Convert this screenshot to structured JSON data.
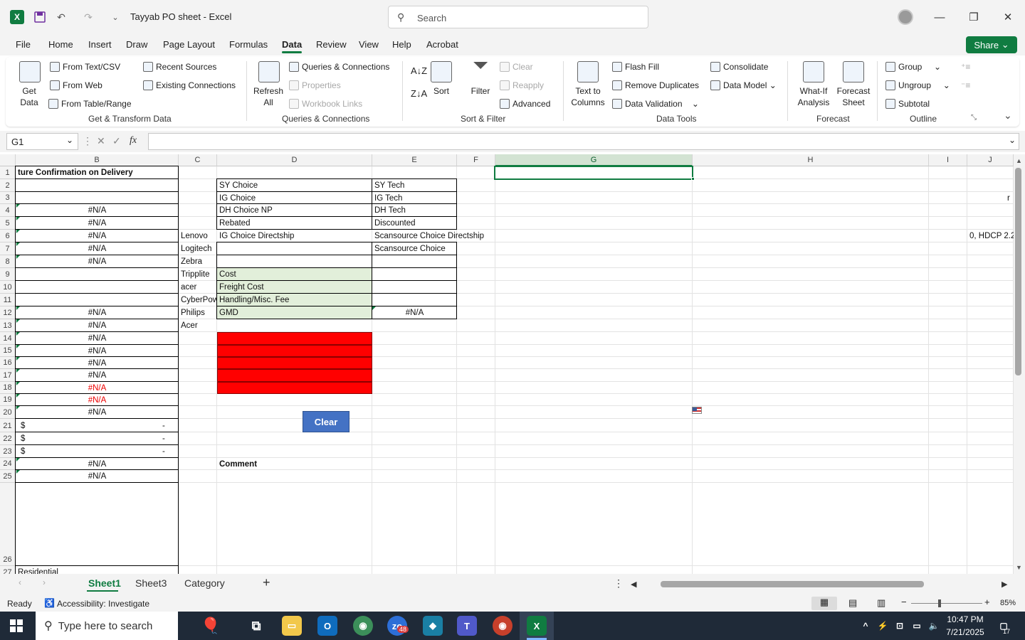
{
  "titlebar": {
    "doc_title": "Tayyab PO sheet  -  Excel",
    "search_placeholder": "Search"
  },
  "menu": {
    "items": [
      "File",
      "Home",
      "Insert",
      "Draw",
      "Page Layout",
      "Formulas",
      "Data",
      "Review",
      "View",
      "Help",
      "Acrobat"
    ],
    "active": "Data",
    "share": "Share"
  },
  "ribbon": {
    "get_data": "Get\nData",
    "from_text_csv": "From Text/CSV",
    "from_web": "From Web",
    "from_table_range": "From Table/Range",
    "recent_sources": "Recent Sources",
    "existing_connections": "Existing Connections",
    "group_get_transform": "Get & Transform Data",
    "refresh_all": "Refresh\nAll",
    "queries_connections": "Queries & Connections",
    "properties": "Properties",
    "workbook_links": "Workbook Links",
    "group_queries": "Queries & Connections",
    "sort": "Sort",
    "filter": "Filter",
    "clear": "Clear",
    "reapply": "Reapply",
    "advanced": "Advanced",
    "group_sort_filter": "Sort & Filter",
    "text_to_columns": "Text to\nColumns",
    "flash_fill": "Flash Fill",
    "remove_duplicates": "Remove Duplicates",
    "data_validation": "Data Validation",
    "consolidate": "Consolidate",
    "data_model": "Data Model",
    "group_data_tools": "Data Tools",
    "what_if": "What-If\nAnalysis",
    "forecast_sheet": "Forecast\nSheet",
    "group_forecast": "Forecast",
    "group_btn": "Group",
    "ungroup": "Ungroup",
    "subtotal": "Subtotal",
    "group_outline": "Outline"
  },
  "formula_bar": {
    "name_box": "G1",
    "formula": ""
  },
  "grid": {
    "columns": [
      "B",
      "C",
      "D",
      "E",
      "F",
      "G",
      "H",
      "I",
      "J"
    ],
    "selected_column": "G",
    "rows": [
      "1",
      "2",
      "3",
      "4",
      "5",
      "6",
      "7",
      "8",
      "9",
      "10",
      "11",
      "12",
      "13",
      "14",
      "15",
      "16",
      "17",
      "18",
      "19",
      "20",
      "21",
      "22",
      "23",
      "24",
      "25",
      "26",
      "27"
    ],
    "cells": {
      "B1": "ture Confirmation on Delivery",
      "B4": "#N/A",
      "B5": "#N/A",
      "B6": "#N/A",
      "B7": "#N/A",
      "B8": "#N/A",
      "B12": "#N/A",
      "B13": "#N/A",
      "B14": "#N/A",
      "B15": "#N/A",
      "B16": "#N/A",
      "B17": "#N/A",
      "B18": "#N/A",
      "B19": "#N/A",
      "B20": "#N/A",
      "B21_sym": "$",
      "B21_val": "-",
      "B22_sym": "$",
      "B22_val": "-",
      "B23_sym": "$",
      "B23_val": "-",
      "B24": "#N/A",
      "B25": "#N/A",
      "B27": "Residential",
      "C6": "Lenovo",
      "C7": "Logitech",
      "C8": "Zebra",
      "C9": "Tripplite",
      "C10": "acer",
      "C11": "CyberPow",
      "C12": "Philips",
      "C13": "Acer",
      "D2": "SY Choice",
      "D3": "IG Choice",
      "D4": "DH Choice NP",
      "D5": " Rebated",
      "D6": "IG Choice Directship",
      "D9": "Cost",
      "D10": "Freight Cost",
      "D11": "Handling/Misc. Fee",
      "D12": "GMD",
      "D24": "Comment",
      "E2": "SY Tech",
      "E3": "IG Tech",
      "E4": "DH Tech",
      "E5": " Discounted",
      "E6": "Scansource Choice Directship",
      "E7": "Scansource Choice",
      "E12": "#N/A",
      "J3": "r",
      "J6": "0, HDCP 2.2"
    },
    "clear_button": "Clear"
  },
  "sheets": {
    "tabs": [
      "Sheet1",
      "Sheet3",
      "Category"
    ],
    "active": "Sheet1",
    "add": "+"
  },
  "status": {
    "ready": "Ready",
    "accessibility": "Accessibility: Investigate",
    "zoom": "85%"
  },
  "taskbar": {
    "search_placeholder": "Type here to search",
    "time": "10:47 PM",
    "date": "7/21/2025",
    "notif_count": "17",
    "badge": "48"
  }
}
